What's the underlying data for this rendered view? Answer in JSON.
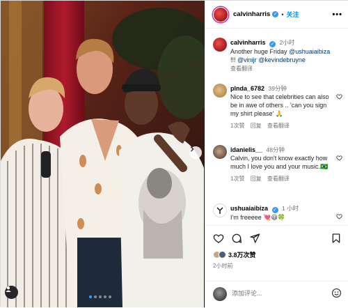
{
  "post": {
    "username": "calvinharris",
    "separator": "•",
    "follow_label": "关注",
    "more_label": "•••"
  },
  "caption": {
    "username": "calvinharris",
    "time": "2小时",
    "line1": "Another huge Friday",
    "mention1": "@ushuaiaibiza",
    "line2": "!!!",
    "mention2": "@vinijr",
    "mention3": "@kevindebruyne",
    "translate": "查看翻译"
  },
  "comments": [
    {
      "username": "plnda_6782",
      "time": "39分钟",
      "text": "Nice to see that celebrities can also be in awe of others .. 'can you sign my shirt please' 🙏",
      "likes": "1次赞",
      "reply": "回复",
      "translate": "查看翻译"
    },
    {
      "username": "idanielis__",
      "time": "48分钟",
      "text": "Calvin, you don't know exactly how much I love you and your music.🇧🇷",
      "likes": "1次赞",
      "reply": "回复",
      "translate": "查看翻译"
    },
    {
      "username": "ushuaiaibiza",
      "time": "1 小时",
      "text": "I'm freeeee 💘😃🍀"
    }
  ],
  "stats": {
    "likes": "3.8万次赞",
    "posted": "2小时前"
  },
  "composer": {
    "placeholder": "添加评论..."
  },
  "carousel": {
    "slide_count": 5,
    "active_index": 0
  },
  "colors": {
    "accent": "#0095f6",
    "verified": "#3897f0"
  }
}
